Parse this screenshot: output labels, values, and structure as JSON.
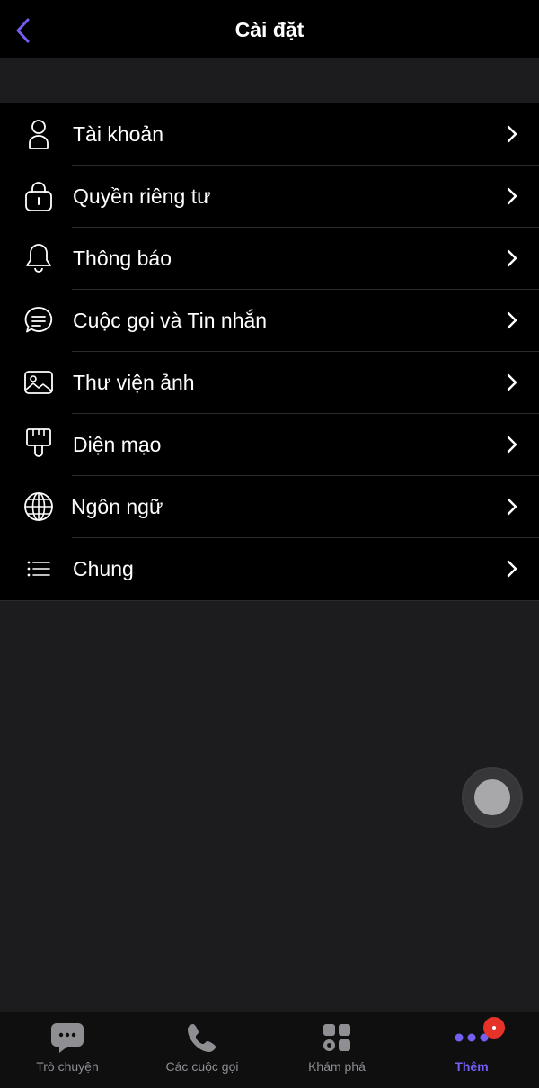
{
  "header": {
    "title": "Cài đặt",
    "back_icon": "chevron-left-icon",
    "accent_color": "#7360f2"
  },
  "settings": {
    "items": [
      {
        "label": "Tài khoản",
        "icon": "person-icon"
      },
      {
        "label": "Quyền riêng tư",
        "icon": "lock-icon"
      },
      {
        "label": "Thông báo",
        "icon": "bell-icon"
      },
      {
        "label": "Cuộc gọi và Tin nhắn",
        "icon": "chat-bubble-icon"
      },
      {
        "label": "Thư viện ảnh",
        "icon": "image-icon"
      },
      {
        "label": "Diện mạo",
        "icon": "paintbrush-icon"
      },
      {
        "label": "Ngôn ngữ",
        "icon": "globe-icon"
      },
      {
        "label": "Chung",
        "icon": "list-icon"
      }
    ]
  },
  "tabbar": {
    "tabs": [
      {
        "label": "Trò chuyện",
        "icon": "chat-icon",
        "active": false
      },
      {
        "label": "Các cuộc gọi",
        "icon": "phone-icon",
        "active": false
      },
      {
        "label": "Khám phá",
        "icon": "explore-grid-icon",
        "active": false
      },
      {
        "label": "Thêm",
        "icon": "more-dots-icon",
        "active": true
      }
    ],
    "active_color": "#7360f2",
    "badge_color": "#e5332a"
  }
}
